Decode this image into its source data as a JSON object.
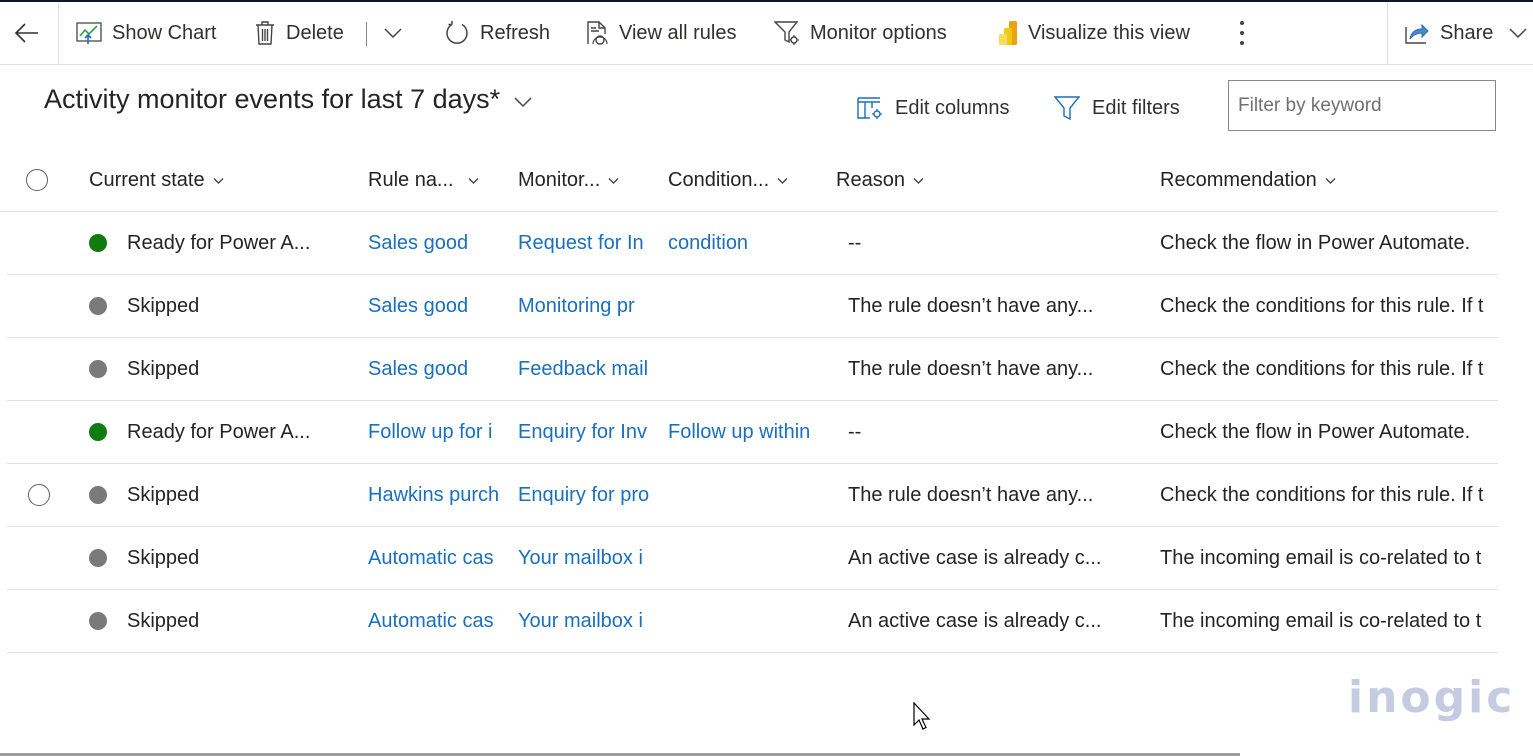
{
  "commandbar": {
    "back_label": "Back",
    "show_chart": "Show Chart",
    "delete": "Delete",
    "refresh": "Refresh",
    "view_all_rules": "View all rules",
    "monitor_options": "Monitor options",
    "visualize": "Visualize this view",
    "share": "Share"
  },
  "view": {
    "title": "Activity monitor events for last 7 days*",
    "edit_columns": "Edit columns",
    "edit_filters": "Edit filters",
    "filter_placeholder": "Filter by keyword",
    "filter_value": ""
  },
  "columns": [
    "Current state",
    "Rule na...",
    "Monitor...",
    "Condition...",
    "Reason",
    "Recommendation"
  ],
  "status_colors": {
    "ready": "#107c10",
    "skipped": "#7a7a7a"
  },
  "rows": [
    {
      "state": "Ready for Power A...",
      "status": "ready",
      "rule": "Sales good",
      "monitor": "Request for In",
      "condition": "condition",
      "reason": "--",
      "recommendation": "Check the flow in Power Automate."
    },
    {
      "state": "Skipped",
      "status": "skipped",
      "rule": "Sales good",
      "monitor": "Monitoring pr",
      "condition": "",
      "reason": "The rule doesn’t have any...",
      "recommendation": "Check the conditions for this rule. If t"
    },
    {
      "state": "Skipped",
      "status": "skipped",
      "rule": "Sales good",
      "monitor": "Feedback mail",
      "condition": "",
      "reason": "The rule doesn’t have any...",
      "recommendation": "Check the conditions for this rule. If t"
    },
    {
      "state": "Ready for Power A...",
      "status": "ready",
      "rule": "Follow up for i",
      "monitor": "Enquiry for Inv",
      "condition": "Follow up within",
      "reason": "--",
      "recommendation": "Check the flow in Power Automate."
    },
    {
      "state": "Skipped",
      "status": "skipped",
      "rule": "Hawkins purch",
      "monitor": "Enquiry for pro",
      "condition": "",
      "reason": "The rule doesn’t have any...",
      "recommendation": "Check the conditions for this rule. If t"
    },
    {
      "state": "Skipped",
      "status": "skipped",
      "rule": "Automatic cas",
      "monitor": "Your mailbox i",
      "condition": "",
      "reason": "An active case is already c...",
      "recommendation": "The incoming email is co-related to t"
    },
    {
      "state": "Skipped",
      "status": "skipped",
      "rule": "Automatic cas",
      "monitor": "Your mailbox i",
      "condition": "",
      "reason": "An active case is already c...",
      "recommendation": "The incoming email is co-related to t"
    }
  ],
  "watermark": "inogic"
}
